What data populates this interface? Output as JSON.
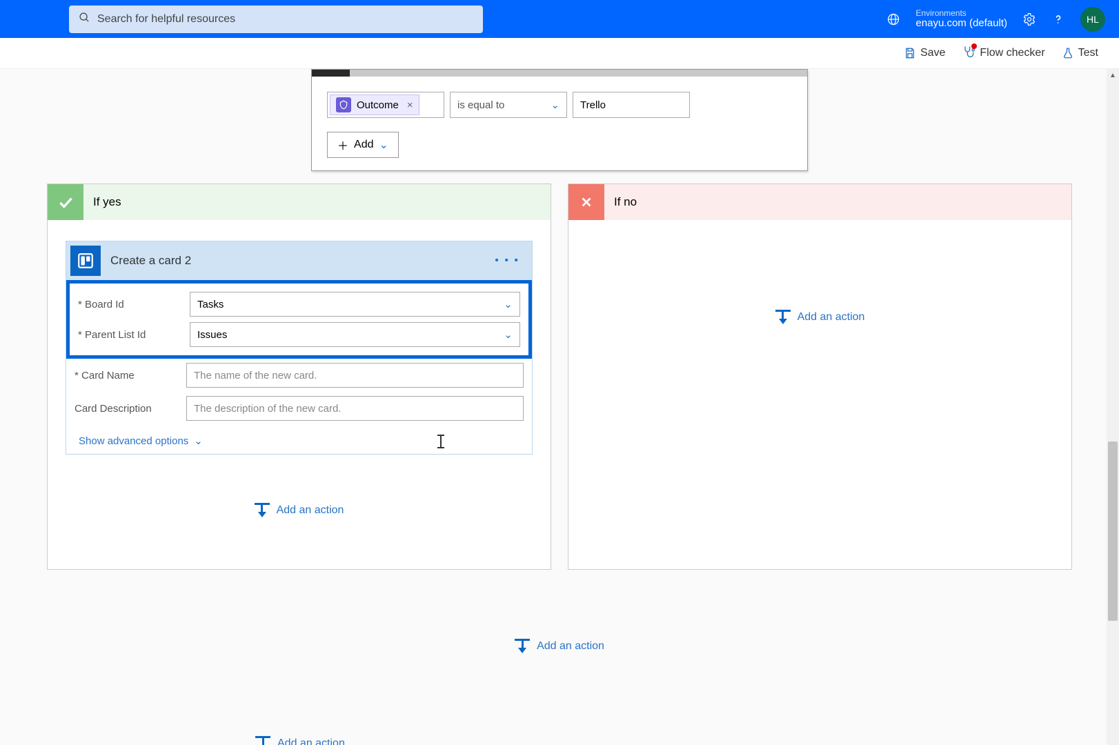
{
  "search": {
    "placeholder": "Search for helpful resources"
  },
  "env": {
    "label": "Environments",
    "name": "enayu.com (default)"
  },
  "avatar": {
    "initials": "HL"
  },
  "toolbar": {
    "save": "Save",
    "flow_checker": "Flow checker",
    "test": "Test"
  },
  "condition": {
    "token": "Outcome",
    "operator": "is equal to",
    "value": "Trello",
    "add_label": "Add"
  },
  "branches": {
    "yes": {
      "title": "If yes"
    },
    "no": {
      "title": "If no"
    }
  },
  "action": {
    "title": "Create a card 2",
    "fields": {
      "board_id": {
        "label": "Board Id",
        "value": "Tasks"
      },
      "parent_list": {
        "label": "Parent List Id",
        "value": "Issues"
      },
      "card_name": {
        "label": "Card Name",
        "placeholder": "The name of the new card."
      },
      "card_desc": {
        "label": "Card Description",
        "placeholder": "The description of the new card."
      }
    },
    "show_advanced": "Show advanced options"
  },
  "add_action": "Add an action"
}
